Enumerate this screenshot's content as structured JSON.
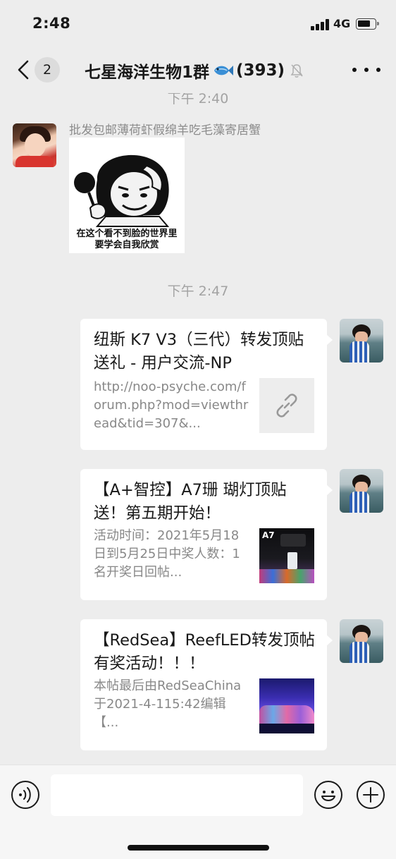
{
  "status_bar": {
    "time": "2:48",
    "network": "4G",
    "icons": [
      "signal-icon",
      "battery-icon"
    ]
  },
  "nav": {
    "back_count": "2",
    "title": "七星海洋生物1群",
    "member_count": "(393)",
    "icons": [
      "back-chevron-icon",
      "fish-emoji-icon",
      "mute-bell-icon",
      "more-dots-icon"
    ]
  },
  "chat": {
    "top_timestamp": "下午 2:40",
    "messages": [
      {
        "type": "sticker",
        "sender": "批发包邮薄荷虾假绵羊吃毛藻寄居蟹",
        "caption_line1": "在这个看不到脸的世界里",
        "caption_line2": "要学会自我欣赏"
      },
      {
        "type": "timestamp",
        "text": "下午 2:47"
      },
      {
        "type": "link-card",
        "title": "纽斯 K7 V3（三代）转发顶贴送礼 - 用户交流-NP",
        "description": "http://noo-psyche.com/forum.php?mod=viewthread&tid=307&...",
        "thumb_icon": "link-icon"
      },
      {
        "type": "link-card",
        "title": "【A+智控】A7珊 瑚灯顶贴送！第五期开始！",
        "description": "活动时间：2021年5月18日到5月25日中奖人数：1名开奖日回帖...",
        "thumb_label": "A7"
      },
      {
        "type": "link-card",
        "title": "【RedSea】ReefLED转发顶帖有奖活动！！！",
        "description": "本帖最后由RedSeaChina于2021-4-115:42编辑【...",
        "thumb_icon": "aquarium-image"
      }
    ]
  },
  "input_bar": {
    "placeholder": "",
    "icons": [
      "voice-icon",
      "emoji-icon",
      "plus-icon"
    ]
  },
  "colors": {
    "background": "#ededed",
    "bubble": "#ffffff",
    "timestamp": "#a3a3a3",
    "secondary_text": "#888888"
  }
}
